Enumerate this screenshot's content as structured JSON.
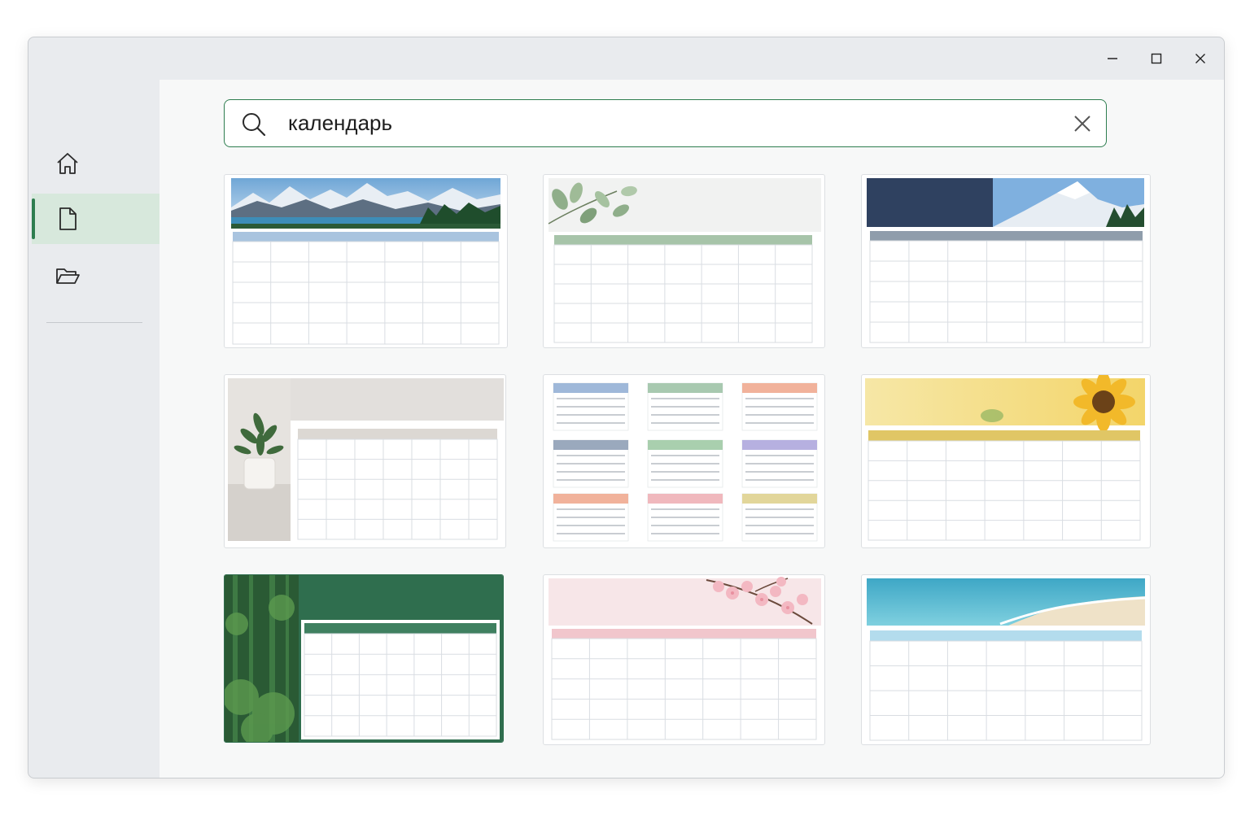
{
  "window": {
    "controls": {
      "minimize_icon": "minimize-icon",
      "maximize_icon": "maximize-icon",
      "close_icon": "close-icon"
    }
  },
  "sidebar": {
    "items": [
      {
        "id": "home",
        "icon": "home-icon",
        "selected": false
      },
      {
        "id": "new",
        "icon": "document-icon",
        "selected": true
      },
      {
        "id": "open",
        "icon": "folder-open-icon",
        "selected": false
      }
    ]
  },
  "search": {
    "value": "календарь",
    "icon": "search-icon",
    "clear_icon": "close-icon"
  },
  "templates": [
    {
      "theme": "mountains-lake",
      "accent": "#a9c4df"
    },
    {
      "theme": "green-leaves",
      "accent": "#a7c4a9"
    },
    {
      "theme": "navy-mountain",
      "accent": "#8f9dab"
    },
    {
      "theme": "plant-in-pot",
      "accent": "#dcd8d3"
    },
    {
      "theme": "twelve-month-pastel",
      "accent": "#9fb8d9"
    },
    {
      "theme": "sunflower",
      "accent": "#e0c665"
    },
    {
      "theme": "forest-green",
      "accent": "#2f6e4e"
    },
    {
      "theme": "cherry-blossom",
      "accent": "#f1c6cc"
    },
    {
      "theme": "beach",
      "accent": "#b3dced"
    }
  ],
  "colors": {
    "accent_green": "#2e7d4f",
    "selected_nav_bg": "#d7e8dc"
  }
}
